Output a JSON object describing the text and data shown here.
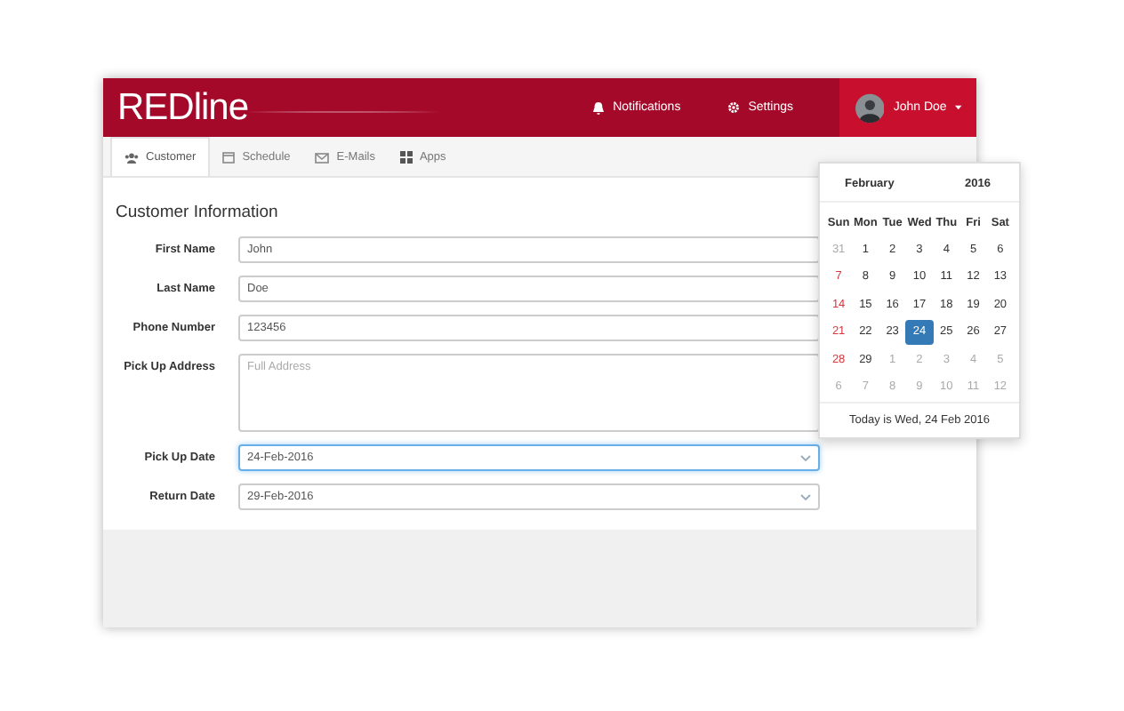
{
  "header": {
    "logo": "REDline",
    "nav": [
      {
        "kind": "bell",
        "label": "Notifications"
      },
      {
        "kind": "gear",
        "label": "Settings"
      }
    ],
    "user": {
      "name": "John Doe"
    }
  },
  "tabs": [
    {
      "kind": "users",
      "label": "Customer",
      "selected": true
    },
    {
      "kind": "calendar",
      "label": "Schedule",
      "selected": false
    },
    {
      "kind": "mail",
      "label": "E-Mails",
      "selected": false
    },
    {
      "kind": "grid",
      "label": "Apps",
      "selected": false
    }
  ],
  "form": {
    "title": "Customer Information",
    "fields": [
      {
        "kind": "input",
        "label": "First Name",
        "value": "John",
        "focused": false
      },
      {
        "kind": "input",
        "label": "Last Name",
        "value": "Doe",
        "focused": false
      },
      {
        "kind": "input",
        "label": "Phone Number",
        "value": "123456",
        "focused": false
      },
      {
        "kind": "textarea",
        "label": "Pick Up Address",
        "placeholder": "Full Address",
        "focused": false
      },
      {
        "kind": "select",
        "label": "Pick Up Date",
        "value": "24-Feb-2016",
        "focused": true
      },
      {
        "kind": "select",
        "label": "Return Date",
        "value": "29-Feb-2016",
        "focused": false
      }
    ]
  },
  "calendar": {
    "month": "February",
    "year": "2016",
    "weekdays": [
      "Sun",
      "Mon",
      "Tue",
      "Wed",
      "Thu",
      "Fri",
      "Sat"
    ],
    "weeks": [
      [
        {
          "day": "31",
          "kind": "muted",
          "selected": false
        },
        {
          "day": "1",
          "kind": "normal",
          "selected": false
        },
        {
          "day": "2",
          "kind": "normal",
          "selected": false
        },
        {
          "day": "3",
          "kind": "normal",
          "selected": false
        },
        {
          "day": "4",
          "kind": "normal",
          "selected": false
        },
        {
          "day": "5",
          "kind": "normal",
          "selected": false
        },
        {
          "day": "6",
          "kind": "normal",
          "selected": false
        }
      ],
      [
        {
          "day": "7",
          "kind": "sunday",
          "selected": false
        },
        {
          "day": "8",
          "kind": "normal",
          "selected": false
        },
        {
          "day": "9",
          "kind": "normal",
          "selected": false
        },
        {
          "day": "10",
          "kind": "normal",
          "selected": false
        },
        {
          "day": "11",
          "kind": "normal",
          "selected": false
        },
        {
          "day": "12",
          "kind": "normal",
          "selected": false
        },
        {
          "day": "13",
          "kind": "normal",
          "selected": false
        }
      ],
      [
        {
          "day": "14",
          "kind": "sunday",
          "selected": false
        },
        {
          "day": "15",
          "kind": "normal",
          "selected": false
        },
        {
          "day": "16",
          "kind": "normal",
          "selected": false
        },
        {
          "day": "17",
          "kind": "normal",
          "selected": false
        },
        {
          "day": "18",
          "kind": "normal",
          "selected": false
        },
        {
          "day": "19",
          "kind": "normal",
          "selected": false
        },
        {
          "day": "20",
          "kind": "normal",
          "selected": false
        }
      ],
      [
        {
          "day": "21",
          "kind": "sunday",
          "selected": false
        },
        {
          "day": "22",
          "kind": "normal",
          "selected": false
        },
        {
          "day": "23",
          "kind": "normal",
          "selected": false
        },
        {
          "day": "24",
          "kind": "normal",
          "selected": true
        },
        {
          "day": "25",
          "kind": "normal",
          "selected": false
        },
        {
          "day": "26",
          "kind": "normal",
          "selected": false
        },
        {
          "day": "27",
          "kind": "normal",
          "selected": false
        }
      ],
      [
        {
          "day": "28",
          "kind": "sunday",
          "selected": false
        },
        {
          "day": "29",
          "kind": "normal",
          "selected": false
        },
        {
          "day": "1",
          "kind": "muted",
          "selected": false
        },
        {
          "day": "2",
          "kind": "muted",
          "selected": false
        },
        {
          "day": "3",
          "kind": "muted",
          "selected": false
        },
        {
          "day": "4",
          "kind": "muted",
          "selected": false
        },
        {
          "day": "5",
          "kind": "muted",
          "selected": false
        }
      ],
      [
        {
          "day": "6",
          "kind": "muted",
          "selected": false
        },
        {
          "day": "7",
          "kind": "muted",
          "selected": false
        },
        {
          "day": "8",
          "kind": "muted",
          "selected": false
        },
        {
          "day": "9",
          "kind": "muted",
          "selected": false
        },
        {
          "day": "10",
          "kind": "muted",
          "selected": false
        },
        {
          "day": "11",
          "kind": "muted",
          "selected": false
        },
        {
          "day": "12",
          "kind": "muted",
          "selected": false
        }
      ]
    ],
    "footer": "Today is Wed, 24 Feb 2016"
  }
}
